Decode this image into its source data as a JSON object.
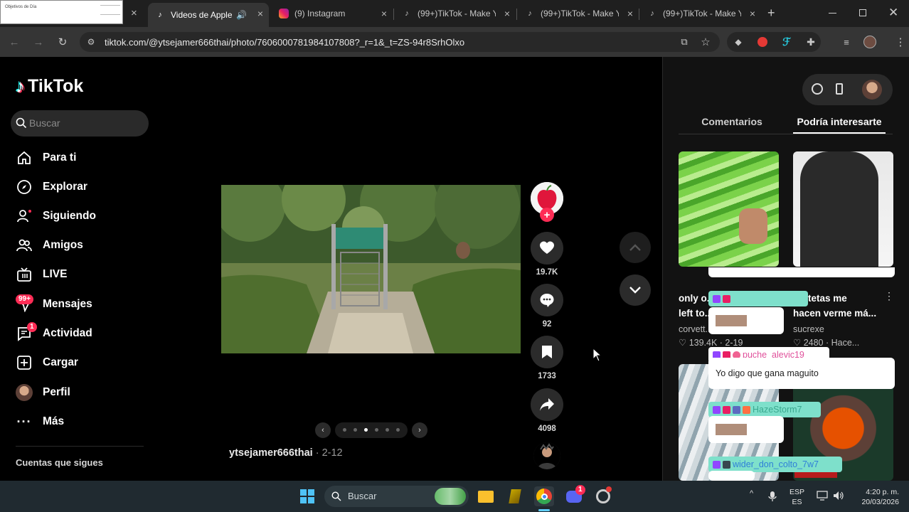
{
  "browser": {
    "tabs": [
      {
        "title": "Objetivos de Día",
        "close": "×"
      },
      {
        "title": "Videos de Apple",
        "close": "×"
      },
      {
        "title": "(9) Instagram",
        "close": "×"
      },
      {
        "title": "(99+)TikTok - Make Y",
        "close": "×"
      },
      {
        "title": "(99+)TikTok - Make Y",
        "close": "×"
      },
      {
        "title": "(99+)TikTok - Make Y",
        "close": "×"
      }
    ],
    "new_tab": "+",
    "url": "tiktok.com/@ytsejamer666thai/photo/7606000781984107808?_r=1&_t=ZS-94r8SrhOlxo"
  },
  "tiktok": {
    "logo": "TikTok",
    "search_placeholder": "Buscar",
    "nav": [
      {
        "label": "Para ti",
        "icon": "home-icon"
      },
      {
        "label": "Explorar",
        "icon": "compass-icon"
      },
      {
        "label": "Siguiendo",
        "icon": "following-icon"
      },
      {
        "label": "Amigos",
        "icon": "friends-icon"
      },
      {
        "label": "LIVE",
        "icon": "live-icon"
      },
      {
        "label": "Mensajes",
        "icon": "messages-icon",
        "badge": "99+"
      },
      {
        "label": "Actividad",
        "icon": "activity-icon",
        "badge": "1"
      },
      {
        "label": "Cargar",
        "icon": "upload-icon"
      },
      {
        "label": "Perfil",
        "icon": "profile-avatar"
      },
      {
        "label": "Más",
        "icon": "more-icon"
      }
    ],
    "following_title": "Cuentas que sigues",
    "post": {
      "author": "ytsejamer666thai",
      "date": " · 2-12",
      "likes": "19.7K",
      "comments": "92",
      "saves": "1733",
      "shares": "4098",
      "follow_plus": "+"
    },
    "carousel": {
      "prev": "‹",
      "next": "›",
      "count": 6,
      "active": 2
    }
  },
  "right_panel": {
    "tabs": [
      "Comentarios",
      "Podría interesarte"
    ],
    "videos": [
      {
        "title": "only o...",
        "title2": "left to...",
        "author": "corvett...",
        "likes": "139.4K",
        "age": "2-19"
      },
      {
        "title": "tetas me",
        "title2": "hacen verme má...",
        "author": "sucrexe",
        "likes": "2480",
        "age": "Hace..."
      }
    ]
  },
  "chat": [
    {
      "user": "",
      "message": ""
    },
    {
      "user": "puche_alevic19",
      "message": "Yo digo que gana maguito"
    },
    {
      "user": "HazeStorm7",
      "message": ""
    },
    {
      "user": "wider_don_colto_7w7",
      "message": ""
    }
  ],
  "taskbar": {
    "search": "Buscar",
    "lang1": "ESP",
    "lang2": "ES",
    "time": "4:20 p. m.",
    "date": "20/03/2026",
    "discord_badge": "1"
  }
}
